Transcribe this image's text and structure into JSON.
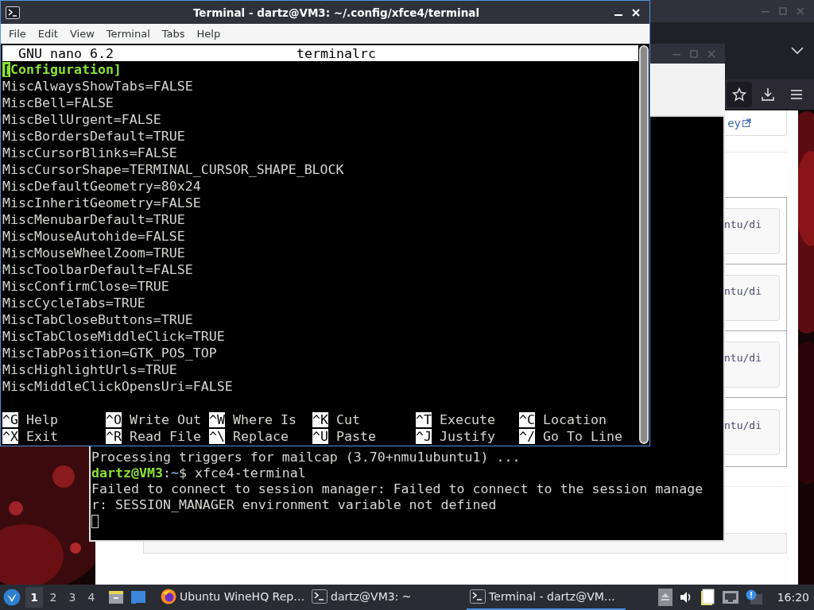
{
  "browser": {
    "page": {
      "link": "ey",
      "snippets": [
        "ntu/di",
        "ntu/di",
        "ntu/di",
        "ntu/di"
      ]
    }
  },
  "background_terminal": {
    "lines": [
      {
        "kind": "output",
        "text": "Processing triggers for mailcap (3.70+nmu1ubuntu1) ..."
      },
      {
        "kind": "prompt",
        "user": "dartz@VM3",
        "separator": ":",
        "path": "~",
        "symbol": "$",
        "command": "xfce4-terminal"
      },
      {
        "kind": "output",
        "text": "Failed to connect to session manager: Failed to connect to the session manage"
      },
      {
        "kind": "output",
        "text": "r: SESSION_MANAGER environment variable not defined"
      },
      {
        "kind": "cursor"
      }
    ]
  },
  "terminal": {
    "title": "Terminal - dartz@VM3: ~/.config/xfce4/terminal",
    "menu": [
      "File",
      "Edit",
      "View",
      "Terminal",
      "Tabs",
      "Help"
    ],
    "nano": {
      "version": "GNU nano 6.2",
      "filename": "terminalrc",
      "lines": [
        {
          "kind": "section",
          "text": "[Configuration]",
          "has_cursor": true
        },
        {
          "kind": "setting",
          "text": "MiscAlwaysShowTabs=FALSE",
          "has_cursor": false
        },
        {
          "kind": "setting",
          "text": "MiscBell=FALSE",
          "has_cursor": false
        },
        {
          "kind": "setting",
          "text": "MiscBellUrgent=FALSE",
          "has_cursor": false
        },
        {
          "kind": "setting",
          "text": "MiscBordersDefault=TRUE",
          "has_cursor": false
        },
        {
          "kind": "setting",
          "text": "MiscCursorBlinks=FALSE",
          "has_cursor": false
        },
        {
          "kind": "setting",
          "text": "MiscCursorShape=TERMINAL_CURSOR_SHAPE_BLOCK",
          "has_cursor": false
        },
        {
          "kind": "setting",
          "text": "MiscDefaultGeometry=80x24",
          "has_cursor": false
        },
        {
          "kind": "setting",
          "text": "MiscInheritGeometry=FALSE",
          "has_cursor": false
        },
        {
          "kind": "setting",
          "text": "MiscMenubarDefault=TRUE",
          "has_cursor": false
        },
        {
          "kind": "setting",
          "text": "MiscMouseAutohide=FALSE",
          "has_cursor": false
        },
        {
          "kind": "setting",
          "text": "MiscMouseWheelZoom=TRUE",
          "has_cursor": false
        },
        {
          "kind": "setting",
          "text": "MiscToolbarDefault=FALSE",
          "has_cursor": false
        },
        {
          "kind": "setting",
          "text": "MiscConfirmClose=TRUE",
          "has_cursor": false
        },
        {
          "kind": "setting",
          "text": "MiscCycleTabs=TRUE",
          "has_cursor": false
        },
        {
          "kind": "setting",
          "text": "MiscTabCloseButtons=TRUE",
          "has_cursor": false
        },
        {
          "kind": "setting",
          "text": "MiscTabCloseMiddleClick=TRUE",
          "has_cursor": false
        },
        {
          "kind": "setting",
          "text": "MiscTabPosition=GTK_POS_TOP",
          "has_cursor": false
        },
        {
          "kind": "setting",
          "text": "MiscHighlightUrls=TRUE",
          "has_cursor": false
        },
        {
          "kind": "setting",
          "text": "MiscMiddleClickOpensUri=FALSE",
          "has_cursor": false
        }
      ],
      "shortcuts": [
        [
          {
            "key": "^G",
            "label": "Help"
          },
          {
            "key": "^O",
            "label": "Write Out"
          },
          {
            "key": "^W",
            "label": "Where Is"
          },
          {
            "key": "^K",
            "label": "Cut"
          },
          {
            "key": "^T",
            "label": "Execute"
          },
          {
            "key": "^C",
            "label": "Location"
          }
        ],
        [
          {
            "key": "^X",
            "label": "Exit"
          },
          {
            "key": "^R",
            "label": "Read File"
          },
          {
            "key": "^\\",
            "label": "Replace"
          },
          {
            "key": "^U",
            "label": "Paste"
          },
          {
            "key": "^J",
            "label": "Justify"
          },
          {
            "key": "^/",
            "label": "Go To Line"
          }
        ]
      ]
    }
  },
  "taskbar": {
    "workspaces": [
      {
        "label": "1",
        "selected": true
      },
      {
        "label": "2",
        "selected": false
      },
      {
        "label": "3",
        "selected": false
      },
      {
        "label": "4",
        "selected": false
      }
    ],
    "tasks": [
      {
        "kind": "browser",
        "label": "Ubuntu WineHQ Rep…",
        "selected": false
      },
      {
        "kind": "terminal",
        "label": "dartz@VM3: ~",
        "selected": false
      },
      {
        "kind": "terminal",
        "label": "Terminal - dartz@VM…",
        "selected": true
      }
    ],
    "clock": "16:20"
  }
}
